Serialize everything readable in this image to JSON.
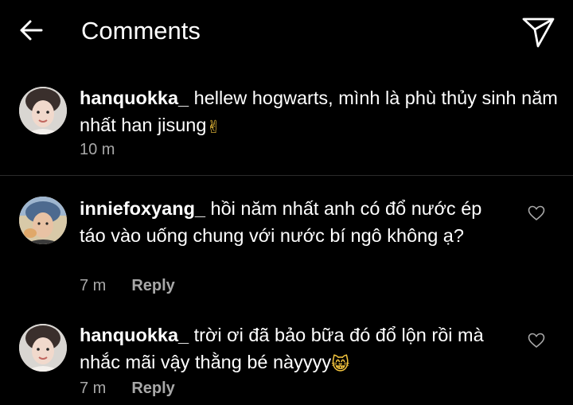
{
  "header": {
    "title": "Comments"
  },
  "icons": {
    "back": "arrow-left-icon",
    "send": "paper-plane-icon",
    "like": "heart-outline-icon",
    "peace": "victory-hand-emoji",
    "cat": "grinning-cat-emoji"
  },
  "caption": {
    "username": "hanquokka_",
    "text": "hellew hogwarts, mình là phù thủy sinh năm nhất han jisung",
    "emoji": "✌",
    "time": "10 m"
  },
  "comments": [
    {
      "username": "inniefoxyang_",
      "text": "hồi năm nhất anh có đổ nước ép táo vào uống chung với nước bí ngô không ạ?",
      "time": "7 m",
      "reply_label": "Reply"
    },
    {
      "username": "hanquokka_",
      "text": "trời ơi đã bảo bữa đó đổ lộn rồi mà nhắc mãi vậy thằng bé nàyyyy",
      "emoji": "😸",
      "time": "7 m",
      "reply_label": "Reply"
    }
  ],
  "colors": {
    "background": "#000000",
    "text": "#ffffff",
    "meta": "#a8a8a8",
    "divider": "#2b2b2b",
    "emoji_yellow": "#f7c73e"
  }
}
